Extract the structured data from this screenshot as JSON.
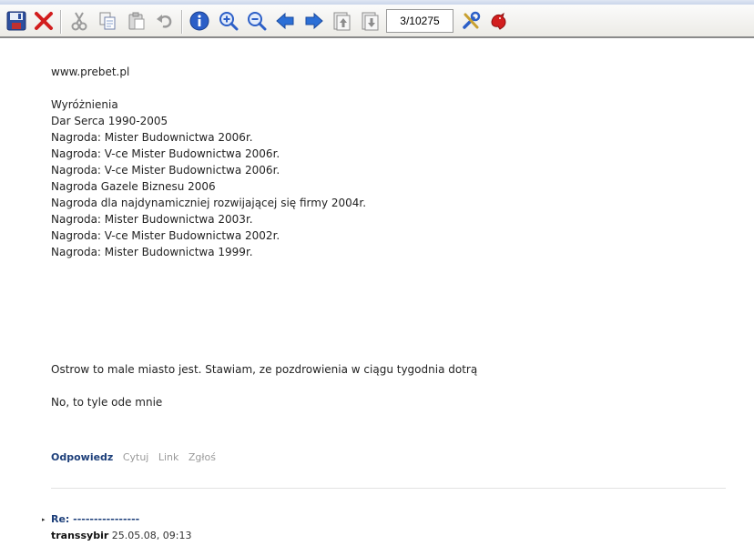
{
  "toolbar": {
    "counter_value": "3/10275",
    "icons": [
      "save-icon",
      "close-icon",
      "cut-icon",
      "copy-icon",
      "paste-icon",
      "undo-icon",
      "info-icon",
      "zoom-in-icon",
      "zoom-out-icon",
      "arrow-left-icon",
      "arrow-right-icon",
      "page-up-icon",
      "page-down-icon",
      "tools-icon",
      "bird-icon"
    ]
  },
  "post": {
    "url": "www.prebet.pl",
    "awards_header": "Wyróżnienia",
    "awards": [
      "Dar Serca 1990-2005",
      "Nagroda: Mister Budownictwa 2006r.",
      "Nagroda: V-ce Mister Budownictwa 2006r.",
      "Nagroda: V-ce Mister Budownictwa 2006r.",
      "Nagroda Gazele Biznesu 2006",
      "Nagroda dla najdynamiczniej rozwijającej się firmy 2004r.",
      "Nagroda: Mister Budownictwa 2003r.",
      "Nagroda: V-ce Mister Budownictwa 2002r.",
      "Nagroda: Mister Budownictwa 1999r."
    ],
    "message_1": "Ostrow to male miasto jest. Stawiam, ze pozdrowienia w ciągu tygodnia dotrą",
    "message_2": "No, to tyle ode mnie"
  },
  "actions": {
    "reply": "Odpowiedz",
    "quote": "Cytuj",
    "link": "Link",
    "report": "Zgłoś"
  },
  "reply_post": {
    "title": "Re: ----------------",
    "author": "transsybir",
    "timestamp": "25.05.08, 09:13"
  },
  "colors": {
    "link_blue": "#1d3f7a",
    "dim_gray": "#9a9a9a"
  }
}
